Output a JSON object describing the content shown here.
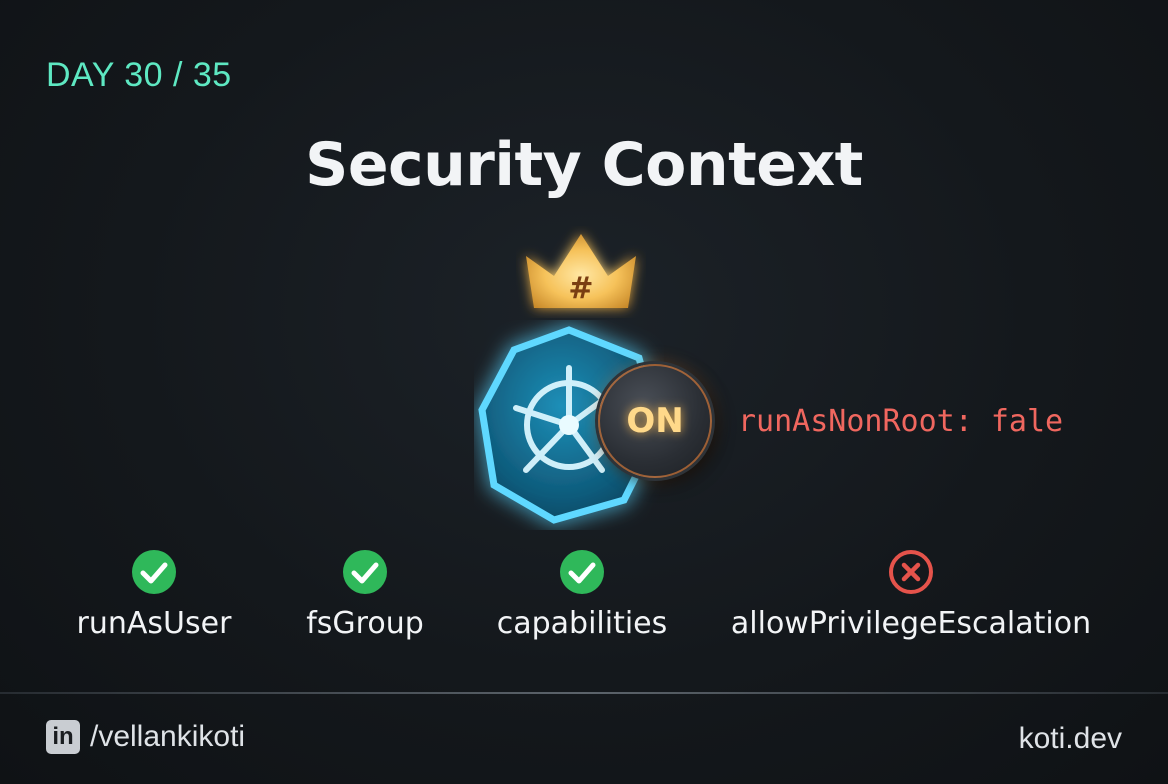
{
  "header": {
    "day_label": "DAY 30 / 35",
    "title": "Security Context"
  },
  "crown": {
    "symbol": "#",
    "icon": "crown-icon"
  },
  "badge": {
    "icon": "kubernetes-helm-icon"
  },
  "switch": {
    "label": "ON",
    "state": "on"
  },
  "code": {
    "text": "runAsNonRoot: fale"
  },
  "features": [
    {
      "label": "runAsUser",
      "status": "check",
      "icon": "check-circle-icon"
    },
    {
      "label": "fsGroup",
      "status": "check",
      "icon": "check-circle-icon"
    },
    {
      "label": "capabilities",
      "status": "check",
      "icon": "check-circle-icon"
    },
    {
      "label": "allowPrivilegeEscalation",
      "status": "cross",
      "icon": "x-circle-icon"
    }
  ],
  "footer": {
    "linkedin_icon_text": "in",
    "handle": "/vellankikoti",
    "site": "koti.dev"
  },
  "colors": {
    "accent_teal": "#5ee8c2",
    "code_red": "#f0675f",
    "check_green": "#2fb85a",
    "cross_red": "#e5534b",
    "crown_gold": "#f6c25a",
    "badge_cyan": "#3fc6ee",
    "switch_text": "#ffd98a"
  }
}
